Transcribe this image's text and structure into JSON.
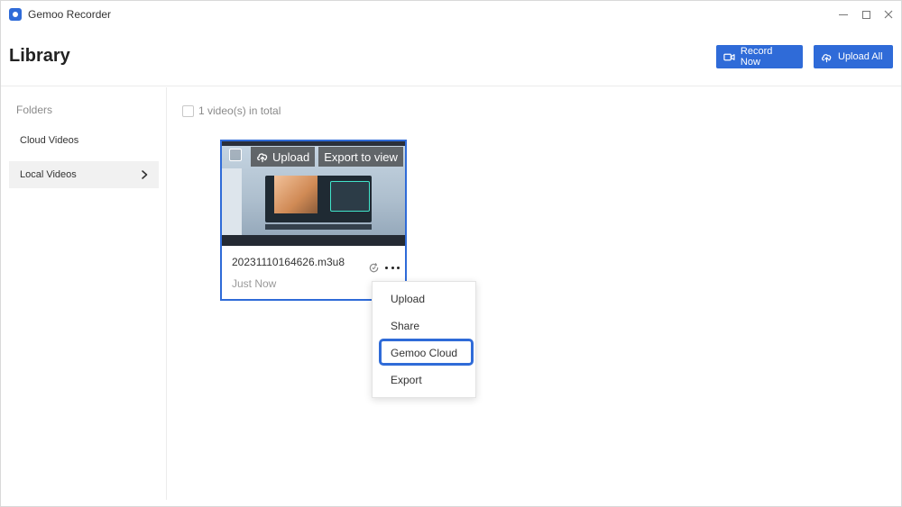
{
  "window": {
    "app_title": "Gemoo Recorder",
    "controls": [
      "minimize-icon",
      "maximize-icon",
      "close-icon"
    ]
  },
  "header": {
    "page_title": "Library",
    "record_now_label": "Record Now",
    "upload_all_label": "Upload All",
    "record_icon": "video-camera-icon",
    "upload_icon": "cloud-upload-icon"
  },
  "sidebar": {
    "folders_label": "Folders",
    "items": [
      {
        "label": "Cloud Videos",
        "selected": false
      },
      {
        "label": "Local Videos",
        "selected": true
      }
    ]
  },
  "main": {
    "total_text": "1 video(s) in total",
    "video": {
      "file_name": "20231110164626.m3u8",
      "time": "Just Now",
      "overlay_upload_label": "Upload",
      "overlay_export_label": "Export to view"
    },
    "context_menu": {
      "items": [
        "Upload",
        "Share",
        "Gemoo Cloud",
        "Export"
      ],
      "highlighted": "Gemoo Cloud"
    }
  },
  "colors": {
    "accent": "#2f6bd8",
    "sidebar_selected": "#f1f1f1",
    "muted_text": "#8a8a8a"
  }
}
